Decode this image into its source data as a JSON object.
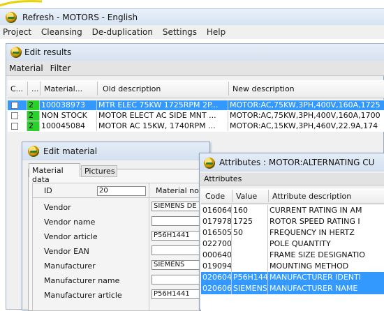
{
  "app": {
    "title": "Refresh - MOTORS - English"
  },
  "menu": [
    "Project",
    "Cleansing",
    "De-duplication",
    "Settings",
    "Help"
  ],
  "edit_results": {
    "title": "Edit results",
    "toolbar": [
      "Material",
      "Filter"
    ],
    "columns": [
      "C...",
      "...",
      "Material...",
      "Old description",
      "New description"
    ],
    "rows": [
      {
        "flag": "2",
        "material": "100038973",
        "old": "MTR ELEC 75KW 1725RPM 2P...",
        "new": "MOTOR:AC,75KW,3PH,400V,160A,1725",
        "selected": true
      },
      {
        "flag": "2",
        "material": "NON STOCK",
        "old": "MOTOR ELECT AC SIDE MNT ...",
        "new": "MOTOR:AC,75KW,3PH,400V,160A,1700",
        "selected": false
      },
      {
        "flag": "2",
        "material": "100045084",
        "old": "MOTOR AC 15KW, 1740RPM ...",
        "new": "MOTOR:AC,15KW,3PH,460V,22.9A,174",
        "selected": false
      }
    ]
  },
  "edit_material": {
    "title": "Edit material",
    "tabs": [
      "Material data",
      "Pictures"
    ],
    "id_label": "ID",
    "id_value": "20",
    "matno_label": "Material no",
    "fields": [
      {
        "label": "Vendor",
        "value": "SIEMENS DE"
      },
      {
        "label": "Vendor name",
        "value": ""
      },
      {
        "label": "Vendor article",
        "value": "P56H1441"
      },
      {
        "label": "Vendor EAN",
        "value": ""
      },
      {
        "label": "Manufacturer",
        "value": "SIEMENS"
      },
      {
        "label": "Manufacturer name",
        "value": ""
      },
      {
        "label": "Manufacturer article",
        "value": "P56H1441"
      }
    ]
  },
  "attributes": {
    "title": "Attributes : MOTOR:ALTERNATING CU",
    "tab": "Attributes",
    "columns": [
      "Code",
      "Value",
      "Attribute description"
    ],
    "rows": [
      {
        "code": "016064",
        "value": "160",
        "desc": "CURRENT RATING IN AM",
        "selected": false
      },
      {
        "code": "017978",
        "value": "1725",
        "desc": "ROTOR SPEED RATING I",
        "selected": false
      },
      {
        "code": "016505",
        "value": "50",
        "desc": "FREQUENCY IN HERTZ",
        "selected": false
      },
      {
        "code": "022700",
        "value": "",
        "desc": "POLE QUANTITY",
        "selected": false
      },
      {
        "code": "000640",
        "value": "",
        "desc": "FRAME SIZE DESIGNATIO",
        "selected": false
      },
      {
        "code": "019094",
        "value": "",
        "desc": "MOUNTING METHOD",
        "selected": false
      },
      {
        "code": "020604",
        "value": "P56H1441",
        "desc": "MANUFACTURER IDENTI",
        "selected": true
      },
      {
        "code": "020606",
        "value": "SIEMENS",
        "desc": "MANUFACTURER NAME",
        "selected": true
      }
    ]
  },
  "colors": {
    "selection": "#3399ff",
    "flag_green": "#2bd12b",
    "accent_yellow": "#e6d200"
  }
}
